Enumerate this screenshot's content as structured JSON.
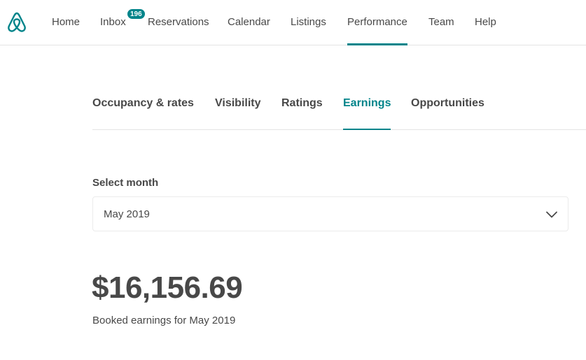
{
  "brand": {
    "logo_icon": "airbnb-logo-icon",
    "accent_color": "#00848a"
  },
  "nav": {
    "items": [
      {
        "label": "Home"
      },
      {
        "label": "Inbox",
        "badge": "196"
      },
      {
        "label": "Reservations"
      },
      {
        "label": "Calendar"
      },
      {
        "label": "Listings"
      },
      {
        "label": "Performance",
        "active": true
      },
      {
        "label": "Team"
      },
      {
        "label": "Help"
      }
    ]
  },
  "subtabs": {
    "items": [
      {
        "label": "Occupancy & rates"
      },
      {
        "label": "Visibility"
      },
      {
        "label": "Ratings"
      },
      {
        "label": "Earnings",
        "active": true
      },
      {
        "label": "Opportunities"
      }
    ]
  },
  "month_select": {
    "label": "Select month",
    "value": "May 2019",
    "icon": "chevron-down-icon"
  },
  "earnings": {
    "amount": "$16,156.69",
    "caption": "Booked earnings for May 2019"
  }
}
